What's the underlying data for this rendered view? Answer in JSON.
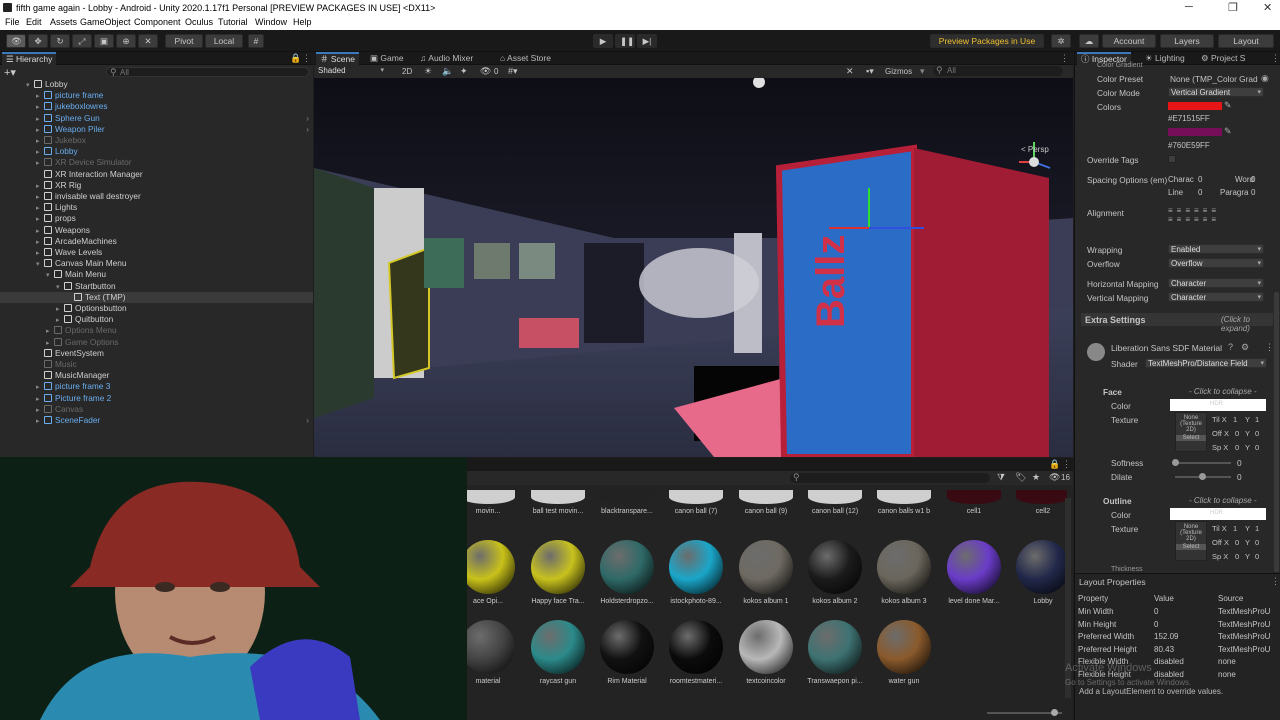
{
  "window": {
    "title": "fifth game again - Lobby - Android - Unity 2020.1.17f1 Personal [PREVIEW PACKAGES IN USE] <DX11>",
    "minimize": "─",
    "maximize": "❐",
    "close": "✕"
  },
  "menu": [
    "File",
    "Edit",
    "Assets",
    "GameObject",
    "Component",
    "Oculus",
    "Tutorial",
    "Window",
    "Help"
  ],
  "toolbar": {
    "pivot": "Pivot",
    "local": "Local",
    "preview_packages": "Preview Packages in Use",
    "account": "Account",
    "layers": "Layers",
    "layout": "Layout"
  },
  "hierarchy": {
    "tab": "Hierarchy",
    "search_placeholder": "All",
    "items": [
      {
        "label": "Lobby",
        "style": "white",
        "indent": 0,
        "arrow": "▾",
        "kind": "scene"
      },
      {
        "label": "picture frame",
        "style": "blue",
        "indent": 1,
        "arrow": "▸"
      },
      {
        "label": "jukeboxlowres",
        "style": "blue",
        "indent": 1,
        "arrow": "▸"
      },
      {
        "label": "Sphere Gun",
        "style": "blue",
        "indent": 1,
        "arrow": "▸"
      },
      {
        "label": "Weapon Piler",
        "style": "blue",
        "indent": 1,
        "arrow": "▸"
      },
      {
        "label": "Jukebox",
        "style": "grey",
        "indent": 1,
        "arrow": "▸"
      },
      {
        "label": "Lobby",
        "style": "blue",
        "indent": 1,
        "arrow": "▸"
      },
      {
        "label": "XR Device Simulator",
        "style": "grey",
        "indent": 1,
        "arrow": "▸"
      },
      {
        "label": "XR Interaction Manager",
        "style": "white",
        "indent": 1,
        "arrow": ""
      },
      {
        "label": "XR Rig",
        "style": "white",
        "indent": 1,
        "arrow": "▸"
      },
      {
        "label": "invisable wall destroyer",
        "style": "white",
        "indent": 1,
        "arrow": "▸"
      },
      {
        "label": "Lights",
        "style": "white",
        "indent": 1,
        "arrow": "▸"
      },
      {
        "label": "props",
        "style": "white",
        "indent": 1,
        "arrow": "▸"
      },
      {
        "label": "Weapons",
        "style": "white",
        "indent": 1,
        "arrow": "▸"
      },
      {
        "label": "ArcadeMachines",
        "style": "white",
        "indent": 1,
        "arrow": "▸"
      },
      {
        "label": "Wave Levels",
        "style": "white",
        "indent": 1,
        "arrow": "▸"
      },
      {
        "label": "Canvas Main Menu",
        "style": "white",
        "indent": 1,
        "arrow": "▾"
      },
      {
        "label": "Main Menu",
        "style": "white",
        "indent": 2,
        "arrow": "▾"
      },
      {
        "label": "Startbutton",
        "style": "white",
        "indent": 3,
        "arrow": "▾"
      },
      {
        "label": "Text (TMP)",
        "style": "white",
        "indent": 4,
        "arrow": "",
        "selected": true
      },
      {
        "label": "Optionsbutton",
        "style": "white",
        "indent": 3,
        "arrow": "▸"
      },
      {
        "label": "Quitbutton",
        "style": "white",
        "indent": 3,
        "arrow": "▸"
      },
      {
        "label": "Options Menu",
        "style": "grey",
        "indent": 2,
        "arrow": "▸"
      },
      {
        "label": "Game Options",
        "style": "grey",
        "indent": 2,
        "arrow": "▸"
      },
      {
        "label": "EventSystem",
        "style": "white",
        "indent": 1,
        "arrow": ""
      },
      {
        "label": "Music",
        "style": "grey",
        "indent": 1,
        "arrow": ""
      },
      {
        "label": "MusicManager",
        "style": "white",
        "indent": 1,
        "arrow": ""
      },
      {
        "label": "picture frame 3",
        "style": "blue",
        "indent": 1,
        "arrow": "▸"
      },
      {
        "label": "Picture frame 2",
        "style": "blue",
        "indent": 1,
        "arrow": "▸"
      },
      {
        "label": "Canvas",
        "style": "grey",
        "indent": 1,
        "arrow": "▸"
      },
      {
        "label": "SceneFader",
        "style": "blue",
        "indent": 1,
        "arrow": "▸"
      }
    ]
  },
  "scene_tabs": [
    "Scene",
    "Game",
    "Audio Mixer",
    "Asset Store"
  ],
  "scene_toolbar": {
    "shading": "Shaded",
    "mode2d": "2D",
    "gizmos": "Gizmos",
    "search": "All",
    "persp": "< Persp",
    "layers_count": "0"
  },
  "project": {
    "count": "16",
    "row1": [
      "movin...",
      "ball test movin...",
      "blacktranspare...",
      "canon ball (7)",
      "canon ball (9)",
      "canon ball (12)",
      "canon balls w1 b",
      "cell1",
      "cell2"
    ],
    "row2": [
      {
        "label": "ace Opi...",
        "color": "#c9c21a"
      },
      {
        "label": "Happy face Tra...",
        "color": "#c8c21e"
      },
      {
        "label": "Holdsterdropzo...",
        "color": "#2f6a68"
      },
      {
        "label": "istockphoto-89...",
        "color": "#1aa6c9"
      },
      {
        "label": "kokos album 1",
        "color": "#6e6a62"
      },
      {
        "label": "kokos album 2",
        "color": "#1b1b1b"
      },
      {
        "label": "kokos album 3",
        "color": "#6b665c"
      },
      {
        "label": "level done Mar...",
        "color": "#6a3cc8"
      },
      {
        "label": "Lobby",
        "color": "#22284a"
      }
    ],
    "row3": [
      {
        "label": "material",
        "color": "#444"
      },
      {
        "label": "raycast gun",
        "color": "#2c8a8a"
      },
      {
        "label": "Rim Material",
        "color": "#111"
      },
      {
        "label": "roomtestmateri...",
        "color": "#0b0b0b"
      },
      {
        "label": "textcoincolor",
        "color": "#b8b8b8"
      },
      {
        "label": "Transwaepon pi...",
        "color": "#3e7272"
      },
      {
        "label": "water gun",
        "color": "#8a5a2c"
      }
    ]
  },
  "inspector": {
    "tabs": [
      "Inspector",
      "Lighting",
      "Project S"
    ],
    "color_gradient": "Color Gradient",
    "color_preset_label": "Color Preset",
    "color_preset_value": "None (TMP_Color Grad",
    "color_mode_label": "Color Mode",
    "color_mode_value": "Vertical Gradient",
    "colors_label": "Colors",
    "color1_hex": "#E71515FF",
    "color1": "#e71515",
    "color2_hex": "#760E59FF",
    "color2": "#760e59",
    "override_tags": "Override Tags",
    "spacing_label": "Spacing Options (em)",
    "spacing_char_label": "Charac",
    "spacing_char": "0",
    "spacing_word_label": "Word",
    "spacing_word": "0",
    "spacing_line_label": "Line",
    "spacing_line": "0",
    "spacing_para_label": "Paragra",
    "spacing_para": "0",
    "alignment": "Alignment",
    "wrapping_label": "Wrapping",
    "wrapping_value": "Enabled",
    "overflow_label": "Overflow",
    "overflow_value": "Overflow",
    "hmap_label": "Horizontal Mapping",
    "hmap_value": "Character",
    "vmap_label": "Vertical Mapping",
    "vmap_value": "Character",
    "extra_settings": "Extra Settings",
    "click_expand": "(Click to expand)",
    "material_name": "Liberation Sans SDF Material",
    "shader_label": "Shader",
    "shader_value": "TextMeshPro/Distance Field",
    "face": "Face",
    "click_collapse": "- Click to collapse -",
    "face_color": "Color",
    "hdr": "HDR",
    "texture": "Texture",
    "tex_none": "None (Texture 2D)",
    "select": "Select",
    "tiling_x": "Til X",
    "tiling_x_val": "1",
    "tiling_y": "Y",
    "tiling_y_val": "1",
    "offset_x": "Off X",
    "offset_x_val": "0",
    "offset_y_val": "0",
    "speed_x": "Sp X",
    "speed_x_val": "0",
    "speed_y_val": "0",
    "softness": "Softness",
    "softness_val": "0",
    "dilate": "Dilate",
    "dilate_val": "0",
    "outline": "Outline",
    "outline_color": "Color",
    "outline_texture": "Texture",
    "thickness": "Thickness"
  },
  "layout_props": {
    "title": "Layout Properties",
    "headers": [
      "Property",
      "Value",
      "Source"
    ],
    "rows": [
      [
        "Min Width",
        "0",
        "TextMeshProU"
      ],
      [
        "Min Height",
        "0",
        "TextMeshProU"
      ],
      [
        "Preferred Width",
        "152.09",
        "TextMeshProU"
      ],
      [
        "Preferred Height",
        "80.43",
        "TextMeshProU"
      ],
      [
        "Flexible Width",
        "disabled",
        "none"
      ],
      [
        "Flexible Height",
        "disabled",
        "none"
      ]
    ],
    "hint": "Add a LayoutElement to override values.",
    "watermark1": "Activate Windows",
    "watermark2": "Go to Settings to activate Windows."
  }
}
